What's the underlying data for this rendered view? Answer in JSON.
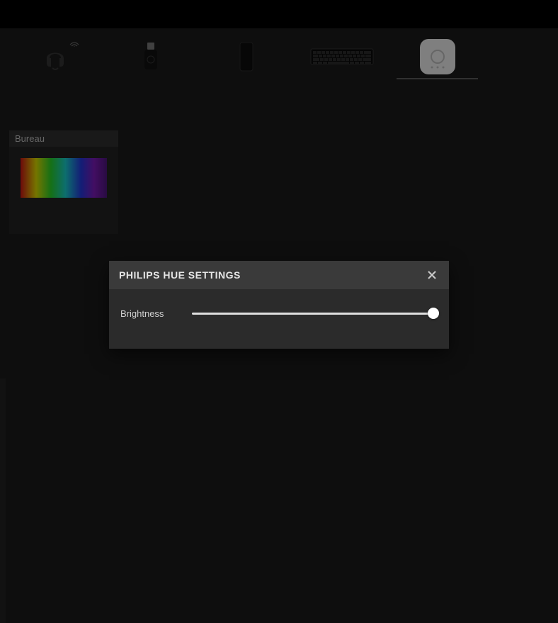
{
  "devices": [
    {
      "name": "headset"
    },
    {
      "name": "usb-dongle"
    },
    {
      "name": "phone"
    },
    {
      "name": "keyboard"
    },
    {
      "name": "hue-bridge",
      "active": true
    }
  ],
  "light_card": {
    "title": "Bureau"
  },
  "modal": {
    "title": "PHILIPS HUE SETTINGS",
    "brightness_label": "Brightness",
    "brightness_value": 100
  }
}
